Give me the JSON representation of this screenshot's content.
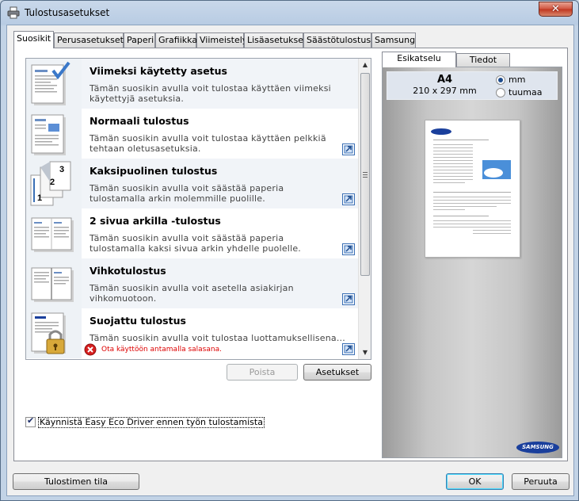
{
  "window": {
    "title": "Tulostusasetukset",
    "close_symbol": "✕"
  },
  "tabs": [
    {
      "label": "Suosikit",
      "active": true
    },
    {
      "label": "Perusasetukset"
    },
    {
      "label": "Paperi"
    },
    {
      "label": "Grafiikka"
    },
    {
      "label": "Viimeistely"
    },
    {
      "label": "Lisäasetukset"
    },
    {
      "label": "Säästötulostus"
    },
    {
      "label": "Samsung"
    }
  ],
  "favorites": [
    {
      "name": "Viimeksi käytetty asetus",
      "desc": "Tämän suosikin avulla voit tulostaa käyttäen viimeksi käytettyjä asetuksia.",
      "icon": "last-used-icon"
    },
    {
      "name": "Normaali tulostus",
      "desc": "Tämän suosikin avulla voit tulostaa käyttäen pelkkiä tehtaan oletusasetuksia.",
      "icon": "normal-print-icon"
    },
    {
      "name": "Kaksipuolinen tulostus",
      "desc": "Tämän suosikin avulla voit säästää paperia tulostamalla arkin molemmille puolille.",
      "icon": "duplex-icon"
    },
    {
      "name": "2 sivua arkilla -tulostus",
      "desc": "Tämän suosikin avulla voit säästää paperia tulostamalla kaksi sivua arkin yhdelle puolelle.",
      "icon": "two-up-icon"
    },
    {
      "name": "Vihkotulostus",
      "desc": "Tämän suosikin avulla voit asetella asiakirjan vihkomuotoon.",
      "icon": "booklet-icon"
    },
    {
      "name": "Suojattu tulostus",
      "desc": "Tämän suosikin avulla voit tulostaa luottamuksellisena...",
      "icon": "secure-print-icon",
      "warning": "Ota käyttöön antamalla salasana."
    }
  ],
  "list_buttons": {
    "delete": "Poista",
    "settings": "Asetukset"
  },
  "eco": {
    "label": "Käynnistä Easy Eco Driver ennen työn tulostamista",
    "checked": true
  },
  "preview": {
    "tabs": [
      "Esikatselu",
      "Tiedot"
    ],
    "paper_name": "A4",
    "paper_size": "210 x 297 mm",
    "units": [
      {
        "label": "mm",
        "selected": true
      },
      {
        "label": "tuumaa",
        "selected": false
      }
    ],
    "brand": "SAMSUNG"
  },
  "footer": {
    "printer_status": "Tulostimen tila",
    "ok": "OK",
    "cancel": "Peruuta"
  }
}
